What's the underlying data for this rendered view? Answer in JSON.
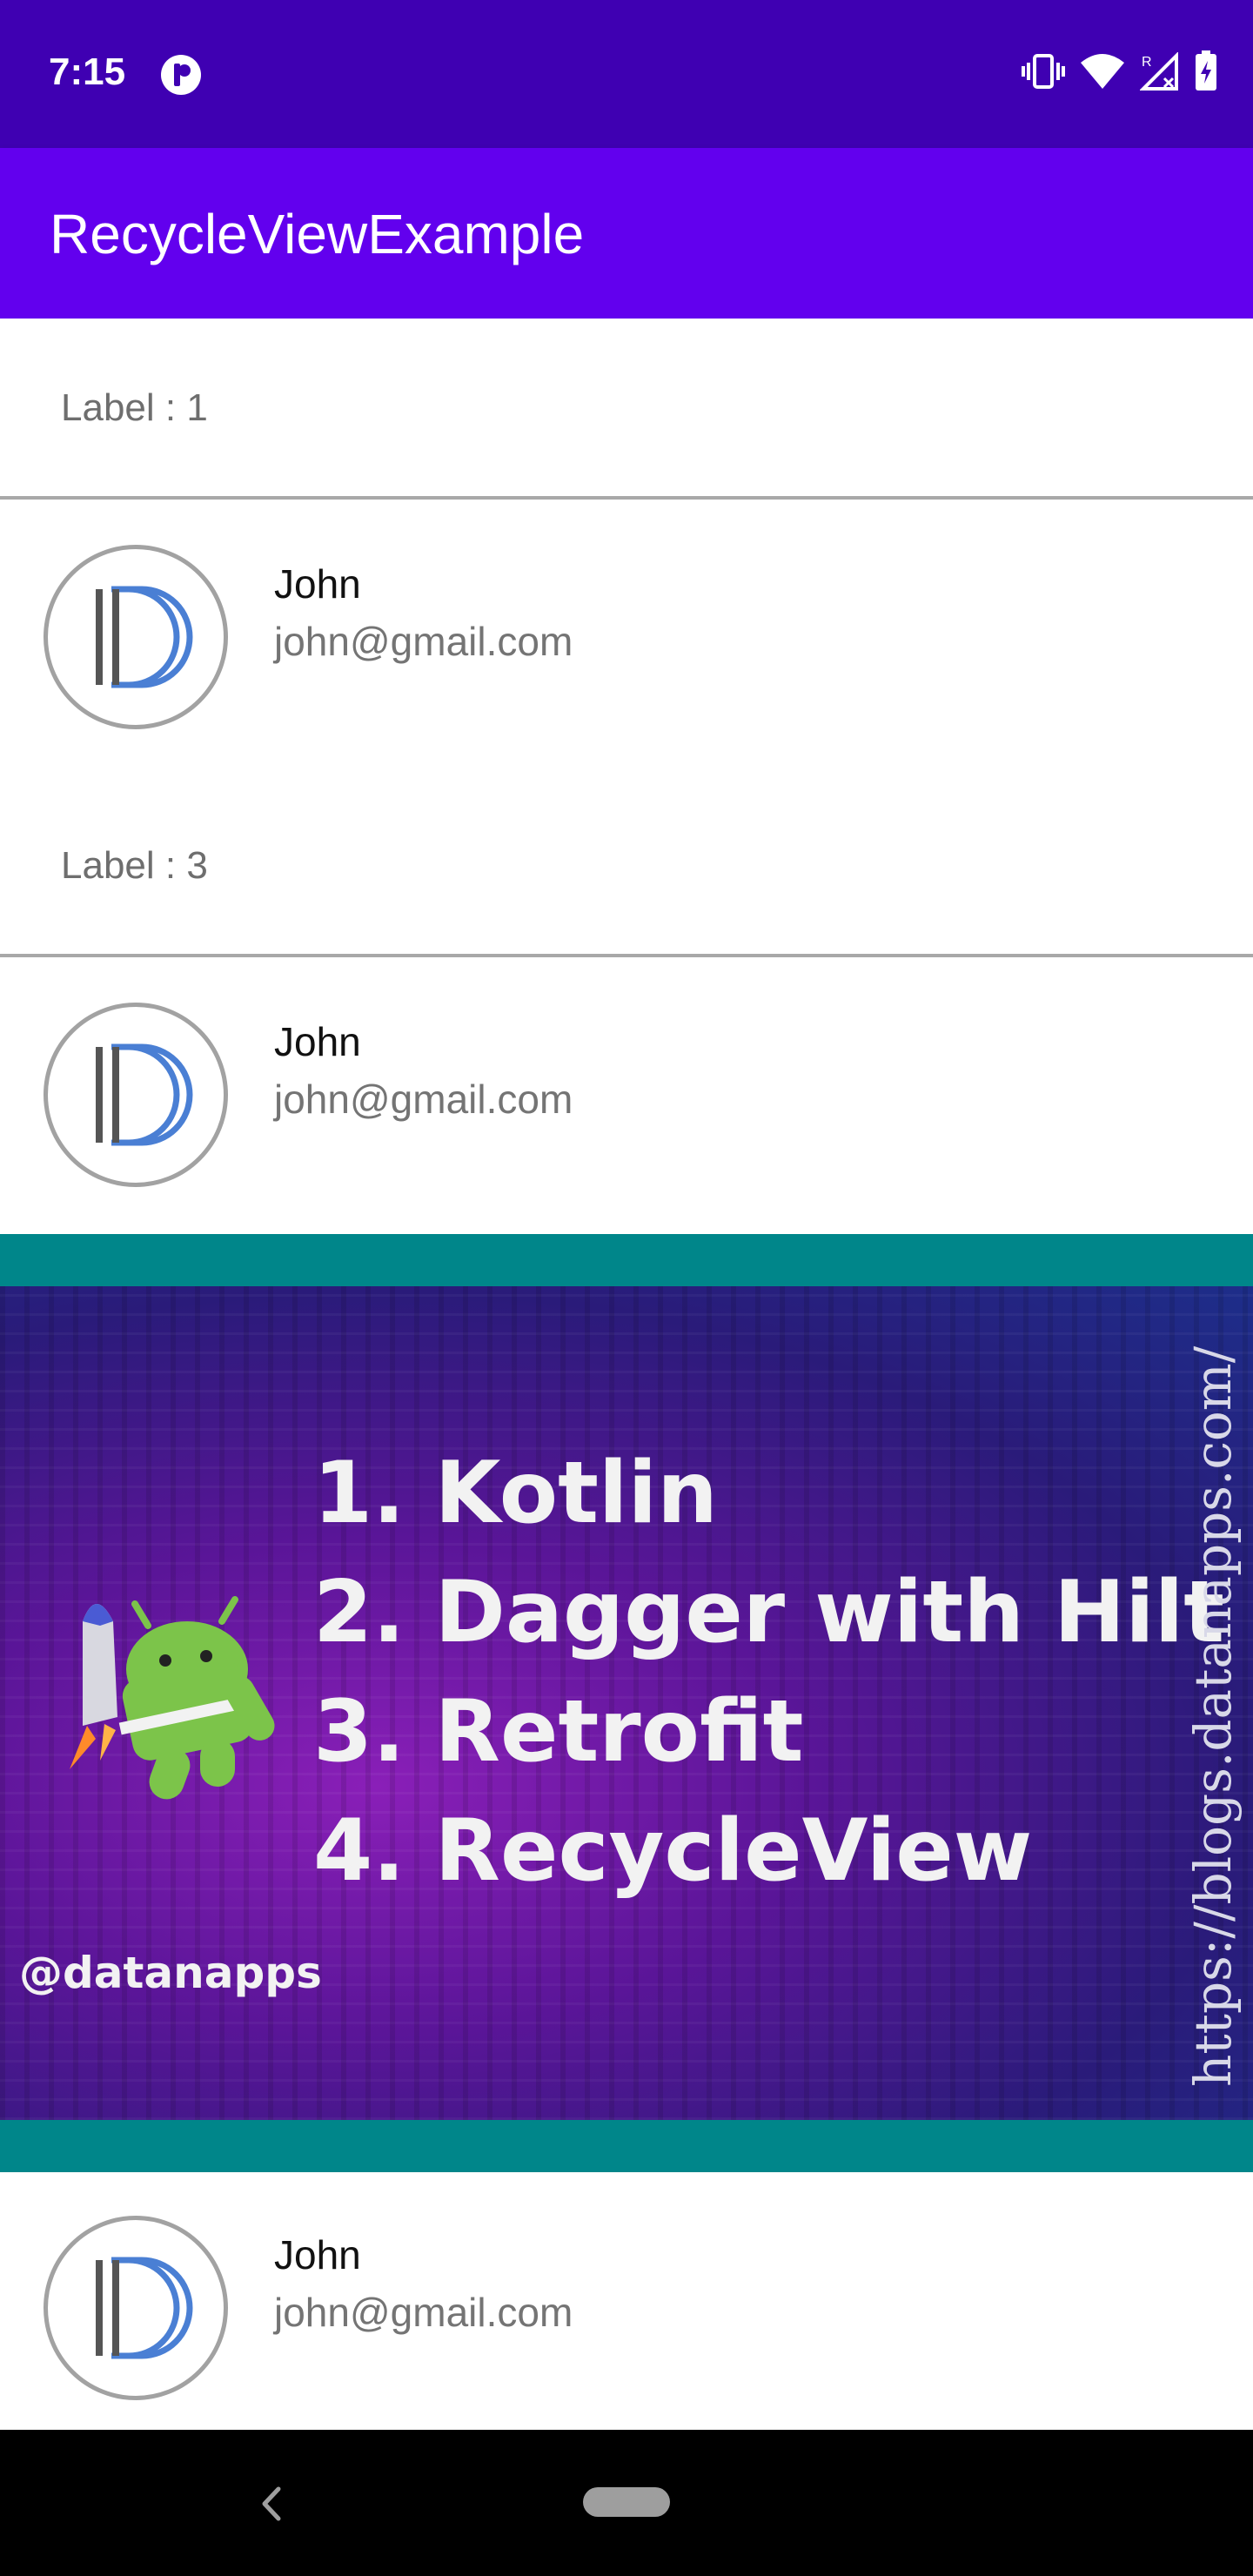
{
  "status_bar": {
    "time": "7:15",
    "left_icon": "app-notification-icon",
    "right_icons": [
      "vibrate-icon",
      "wifi-icon",
      "signal-roaming-icon",
      "battery-charging-icon"
    ]
  },
  "app_bar": {
    "title": "RecycleViewExample",
    "color": "#6200ee"
  },
  "list": {
    "label_1": "Label : 1",
    "label_3": "Label : 3",
    "users": [
      {
        "name": "John",
        "email": "john@gmail.com",
        "avatar_icon": "dagger-logo-icon"
      },
      {
        "name": "John",
        "email": "john@gmail.com",
        "avatar_icon": "dagger-logo-icon"
      },
      {
        "name": "John",
        "email": "john@gmail.com",
        "avatar_icon": "dagger-logo-icon"
      }
    ]
  },
  "banner": {
    "items": [
      "1. Kotlin",
      "2. Dagger with Hilt",
      "3. Retrofit",
      "4. RecycleView"
    ],
    "handle": "@datanapps",
    "url": "https://blogs.datanapps.com/",
    "mascot_icon": "android-jetpack-icon",
    "frame_color": "#00868a"
  },
  "nav_bar": {
    "back_icon": "back-chevron-icon",
    "home_icon": "home-pill-icon"
  }
}
